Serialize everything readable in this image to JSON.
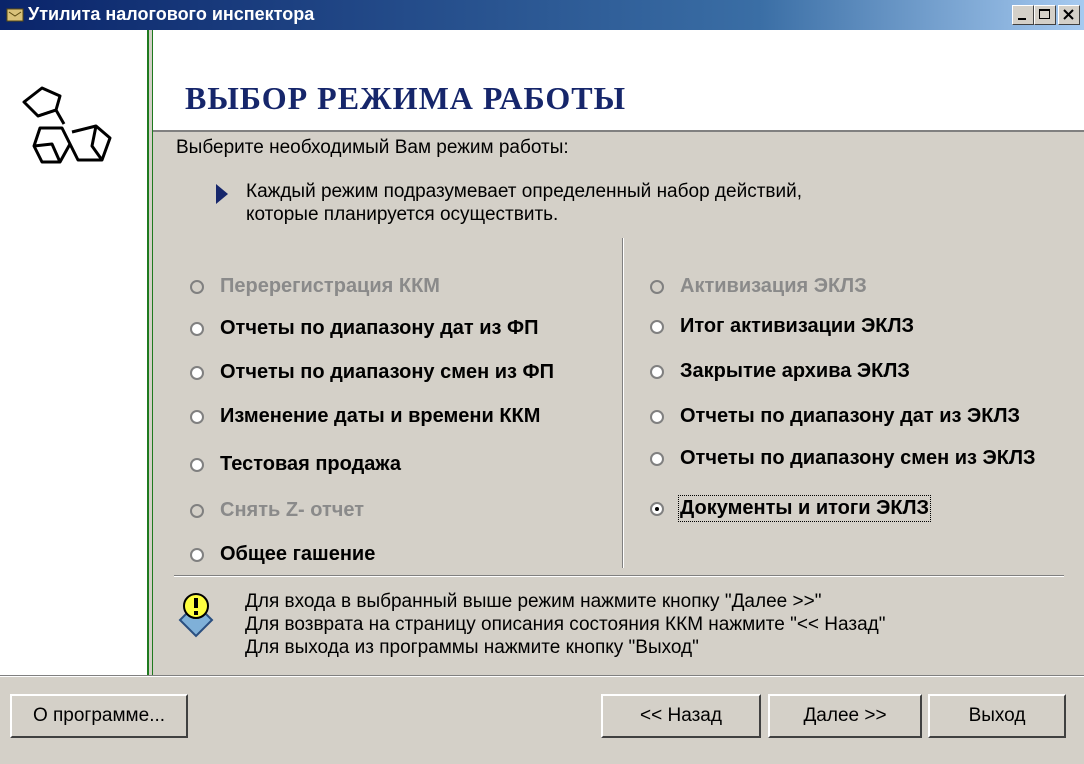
{
  "window": {
    "title": "Утилита налогового инспектора"
  },
  "header": {
    "title": "ВЫБОР РЕЖИМА РАБОТЫ"
  },
  "subtitle": "Выберите необходимый Вам режим работы:",
  "hint": {
    "line1": "Каждый режим подразумевает определенный набор действий,",
    "line2": "которые планируется осуществить."
  },
  "modes_left": [
    {
      "label": "Перерегистрация ККМ",
      "enabled": false,
      "checked": false
    },
    {
      "label": "Отчеты по диапазону дат из ФП",
      "enabled": true,
      "checked": false
    },
    {
      "label": "Отчеты по диапазону смен из ФП",
      "enabled": true,
      "checked": false
    },
    {
      "label": "Изменение даты и времени ККМ",
      "enabled": true,
      "checked": false
    },
    {
      "label": "Тестовая продажа",
      "enabled": true,
      "checked": false
    },
    {
      "label": "Снять Z- отчет",
      "enabled": false,
      "checked": false
    },
    {
      "label": "Общее гашение",
      "enabled": true,
      "checked": false
    }
  ],
  "modes_right": [
    {
      "label": "Активизация ЭКЛЗ",
      "enabled": false,
      "checked": false
    },
    {
      "label": "Итог активизации ЭКЛЗ",
      "enabled": true,
      "checked": false
    },
    {
      "label": "Закрытие архива ЭКЛЗ",
      "enabled": true,
      "checked": false
    },
    {
      "label": "Отчеты по диапазону дат из ЭКЛЗ",
      "enabled": true,
      "checked": false
    },
    {
      "label": "Отчеты по диапазону смен из ЭКЛЗ",
      "enabled": true,
      "checked": false
    },
    {
      "label": "Документы и итоги ЭКЛЗ",
      "enabled": true,
      "checked": true
    }
  ],
  "info": {
    "line1": "Для входа в выбранный выше режим нажмите кнопку \"Далее >>\"",
    "line2": "Для возврата на страницу описания состояния ККМ нажмите \"<< Назад\"",
    "line3": "Для выхода из программы нажмите кнопку \"Выход\""
  },
  "buttons": {
    "about": "О программе...",
    "back": "<< Назад",
    "next": "Далее >>",
    "exit": "Выход"
  },
  "icons": {
    "app": "app-icon",
    "logo": "cubes-logo-icon",
    "info": "lightbulb-icon"
  },
  "colors": {
    "title_accent": "#16266b",
    "panel_line": "#1f7a1f",
    "titlebar": "#0a246a"
  }
}
